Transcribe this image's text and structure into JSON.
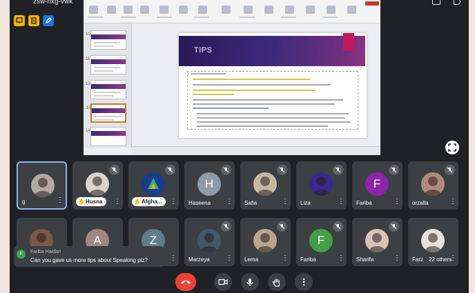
{
  "meeting": {
    "code": "zsw-rikg-vwk",
    "badges": [
      {
        "icon": "presenter-icon",
        "color": "#f4b400"
      },
      {
        "icon": "note-icon",
        "color": "#f4b400"
      },
      {
        "icon": "pen-icon",
        "color": "#1a73e8"
      }
    ]
  },
  "presentation": {
    "slide_title": "TIPS",
    "thumbnail_numbers": [
      "10",
      "11",
      "12",
      "13",
      "14"
    ],
    "selected_thumbnail": 3
  },
  "participants": [
    {
      "name": "g",
      "avatar_type": "photo",
      "avatar_color": "#b5a8a1",
      "muted": false,
      "active": true
    },
    {
      "name": "Husna",
      "avatar_type": "photo",
      "avatar_color": "#d9d2cf",
      "muted": true,
      "hand_raised": true
    },
    {
      "name": "Afgha...",
      "avatar_type": "logo",
      "avatar_color": "#1b3d8f",
      "muted": true,
      "hand_raised": true
    },
    {
      "name": "Haseena",
      "avatar_letter": "H",
      "avatar_color": "#8d9aa7",
      "muted": true
    },
    {
      "name": "Safia",
      "avatar_type": "photo",
      "avatar_color": "#c6b9a3",
      "muted": true
    },
    {
      "name": "Liza",
      "avatar_type": "photo",
      "avatar_color": "#3b2a8a",
      "muted": true
    },
    {
      "name": "Fariba",
      "avatar_letter": "F",
      "avatar_color": "#8e24aa",
      "muted": true
    },
    {
      "name": "orzalla",
      "avatar_type": "photo",
      "avatar_color": "#b08a7a",
      "muted": true
    },
    {
      "name": "",
      "avatar_type": "photo",
      "avatar_color": "#7a5a48",
      "muted": false
    },
    {
      "name": "",
      "avatar_letter": "A",
      "avatar_color": "#a1887f",
      "muted": false
    },
    {
      "name": "",
      "avatar_letter": "Z",
      "avatar_color": "#607d8b",
      "muted": false
    },
    {
      "name": "Marzeya",
      "avatar_type": "photo",
      "avatar_color": "#44586a",
      "muted": true
    },
    {
      "name": "Lema",
      "avatar_type": "photo",
      "avatar_color": "#b7a58f",
      "muted": true
    },
    {
      "name": "Fariba",
      "avatar_letter": "F",
      "avatar_color": "#43a047",
      "muted": true
    },
    {
      "name": "Sharifa",
      "avatar_type": "photo",
      "avatar_color": "#d7c3b8",
      "muted": true
    },
    {
      "name": "Farz",
      "avatar_type": "photo",
      "avatar_color": "#e4e1de",
      "muted": false,
      "others_label": "22 others"
    }
  ],
  "chat": {
    "avatar_letter": "F",
    "sender": "Fariba Haidari",
    "message": "Can you gave us more tips about Speaking plz?"
  },
  "controls": [
    {
      "icon": "end-call-icon",
      "color": "#ea4335"
    },
    {
      "icon": "camera-off-icon"
    },
    {
      "icon": "microphone-icon"
    },
    {
      "icon": "raise-hand-icon"
    },
    {
      "icon": "more-options-icon"
    }
  ]
}
